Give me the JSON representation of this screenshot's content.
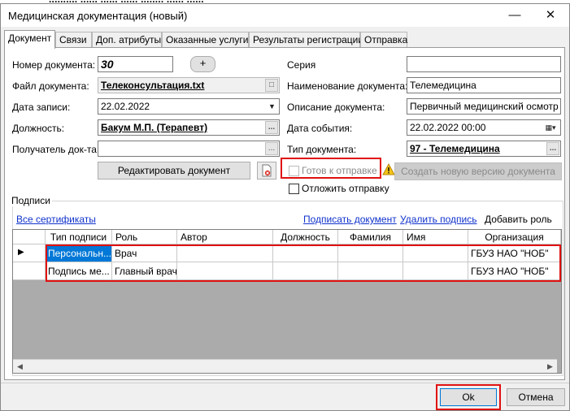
{
  "window": {
    "title": "Медицинская документация (новый)"
  },
  "tabs": [
    "Документ",
    "Связи",
    "Доп. атрибуты",
    "Оказанные услуги",
    "Результаты регистрации",
    "Отправка"
  ],
  "form": {
    "doc_number_label": "Номер документа:",
    "doc_number_value": "30",
    "add_button": "+",
    "series_label": "Серия",
    "series_value": "",
    "doc_file_label": "Файл документа:",
    "doc_file_value": "Телеконсультация.txt",
    "doc_name_label": "Наименование документа:",
    "doc_name_value": "Телемедицина",
    "record_date_label": "Дата записи:",
    "record_date_value": "22.02.2022",
    "doc_description_label": "Описание документа:",
    "doc_description_value": "Первичный медицинский осмотр",
    "position_label": "Должность:",
    "position_value": "Бакум М.П. (Терапевт)",
    "event_date_label": "Дата события:",
    "event_date_value": "22.02.2022 00:00",
    "recipient_label": "Получатель док-та",
    "recipient_value": "",
    "doc_type_label": "Тип документа:",
    "doc_type_value": "97 - Телемедицина",
    "edit_doc_button": "Редактировать документ",
    "ready_to_send_label": "Готов к отправке",
    "postpone_send_label": "Отложить отправку",
    "new_version_button": "Создать новую версию документа"
  },
  "signatures": {
    "group_title": "Подписи",
    "all_certificates_link": "Все сертификаты",
    "sign_document_link": "Подписать документ",
    "delete_signature_link": "Удалить подпись",
    "add_role_label": "Добавить роль",
    "columns": [
      "Тип подписи",
      "Роль",
      "Автор",
      "Должность",
      "Фамилия",
      "Имя",
      "Организация"
    ],
    "rows": [
      [
        "Персональн...",
        "Врач",
        "",
        "",
        "",
        "",
        "ГБУЗ НАО \"НОБ\""
      ],
      [
        "Подпись ме...",
        "Главный врач",
        "",
        "",
        "",
        "",
        "ГБУЗ НАО \"НОБ\""
      ]
    ]
  },
  "footer": {
    "ok_button": "Ok",
    "cancel_button": "Отмена"
  },
  "colors": {
    "highlight": "#e01010",
    "selection": "#0078d7",
    "link": "#1033cc"
  }
}
